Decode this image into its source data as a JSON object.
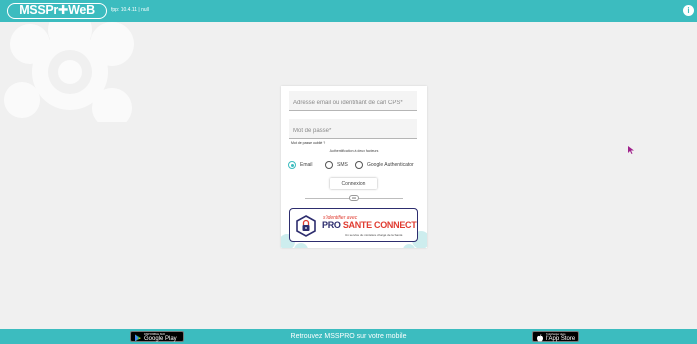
{
  "header": {
    "logo_text": "MSSPr✚WeB",
    "version": "fpp: 10.4.11 | null",
    "info_icon": "info-icon",
    "info_glyph": "i"
  },
  "colors": {
    "brand_teal": "#3cbcbf",
    "background": "#f0f0f0",
    "psc_navy": "#2d2d6e",
    "psc_red": "#e03c31"
  },
  "login": {
    "email_placeholder": "Adresse email ou identifiant de carl CPS*",
    "password_placeholder": "Mot de passe*",
    "forgot_password": "Mot de passe oublié ?",
    "twofa_title": "Authentification à deux facteurs",
    "twofa_options": [
      {
        "label": "Email",
        "selected": true
      },
      {
        "label": "SMS",
        "selected": false
      },
      {
        "label": "Google Authenticator",
        "selected": false
      }
    ],
    "submit_label": "Connexion",
    "divider_label": "ou"
  },
  "pro_sante_connect": {
    "top_line": "s'identifier avec",
    "brand_part1": "PRO ",
    "brand_part2": "SANTE CONNECT",
    "subtitle": "Un service du ministère chargé de la Santé",
    "icon": "psc-lock-shield-icon"
  },
  "footer": {
    "message": "Retrouvez MSSPRO sur votre mobile",
    "google_play_small": "DISPONIBLE SUR",
    "google_play_big": "Google Play",
    "app_store_small": "Télécharger dans",
    "app_store_big": "l'App Store"
  }
}
